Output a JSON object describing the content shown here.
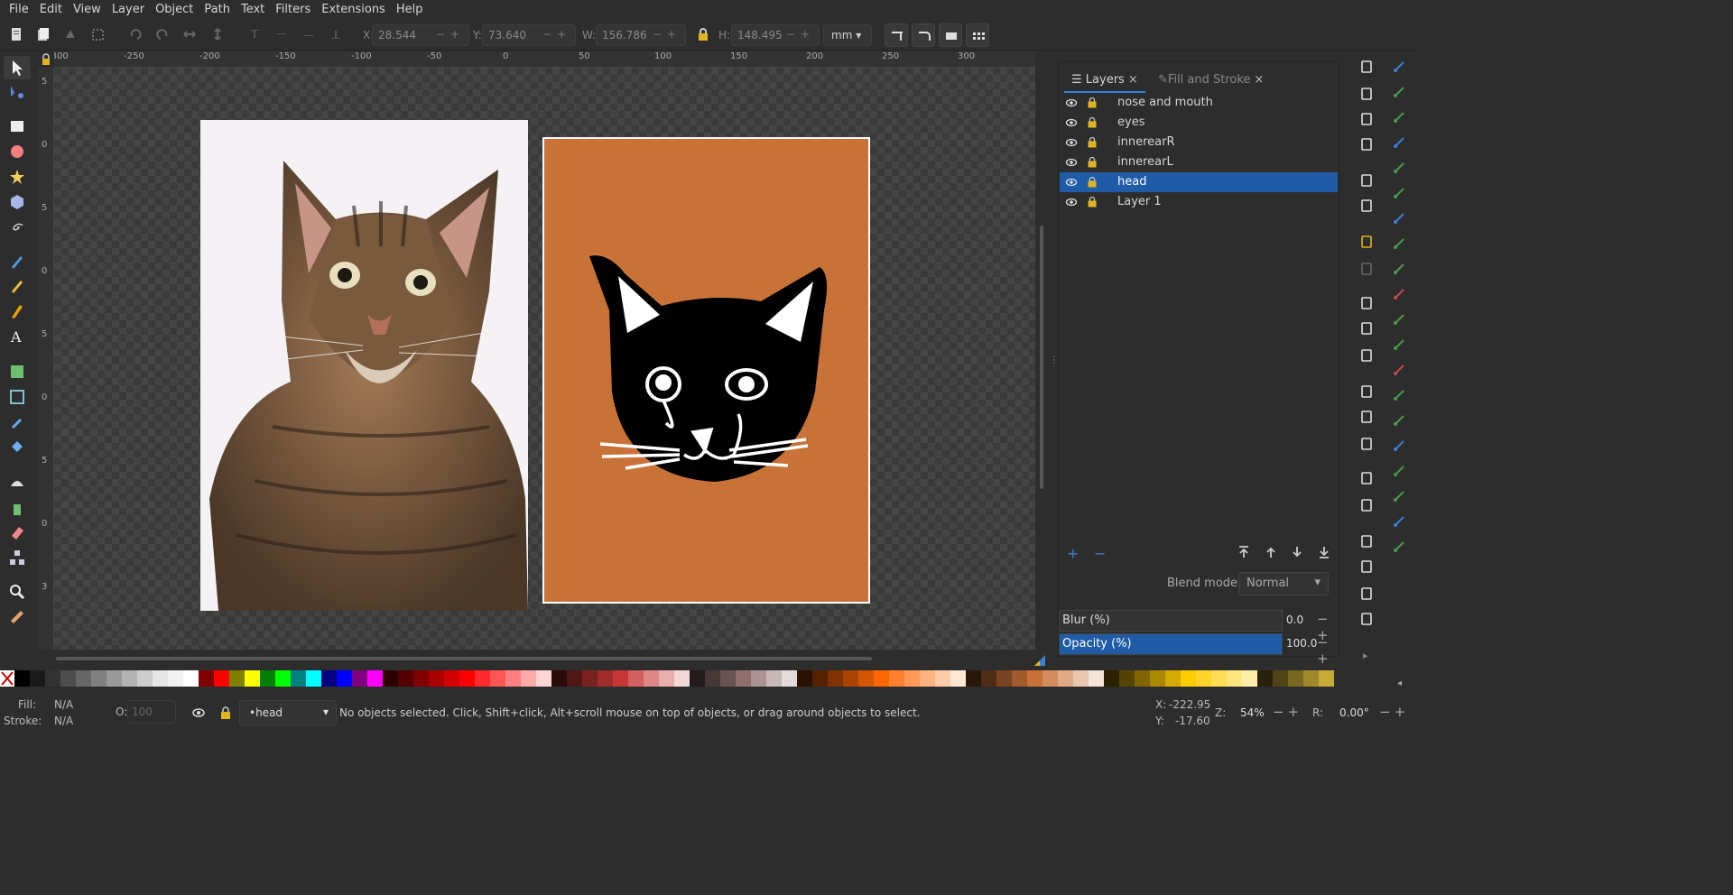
{
  "menu": [
    "File",
    "Edit",
    "View",
    "Layer",
    "Object",
    "Path",
    "Text",
    "Filters",
    "Extensions",
    "Help"
  ],
  "toolbar": {
    "x_label": "X:",
    "x_value": "28.544",
    "y_label": "Y:",
    "y_value": "73.640",
    "w_label": "W:",
    "w_value": "156.786",
    "h_label": "H:",
    "h_value": "148.495",
    "unit": "mm"
  },
  "ruler": {
    "top_ticks": [
      "-300",
      "-250",
      "-200",
      "-150",
      "-100",
      "-50",
      "0",
      "50",
      "100",
      "150",
      "200",
      "250",
      "300"
    ],
    "left_ticks": [
      "5",
      "0",
      "5",
      "0",
      "5",
      "0",
      "5",
      "0",
      "3"
    ]
  },
  "dock": {
    "tab_layers": "Layers",
    "tab_fill_stroke": "Fill and Stroke",
    "layers": [
      {
        "name": "nose and mouth",
        "selected": false
      },
      {
        "name": "eyes",
        "selected": false
      },
      {
        "name": "innerearR",
        "selected": false
      },
      {
        "name": "innerearL",
        "selected": false
      },
      {
        "name": "head",
        "selected": true
      },
      {
        "name": "Layer 1",
        "selected": false
      }
    ],
    "add_label": "+",
    "remove_label": "−",
    "blend_mode_label": "Blend mode:",
    "blend_mode_value": "Normal",
    "blur_label": "Blur (%)",
    "blur_value": "0.0",
    "opacity_label": "Opacity (%)",
    "opacity_value": "100.0"
  },
  "status": {
    "fill_label": "Fill:",
    "fill_value": "N/A",
    "stroke_label": "Stroke:",
    "stroke_value": "N/A",
    "opacity_label": "O:",
    "opacity_value": "100",
    "layer_value": "•head",
    "message": "No objects selected. Click, Shift+click, Alt+scroll mouse on top of objects, or drag around objects to select.",
    "x_label": "X:",
    "x_value": "-222.95",
    "y_label": "Y:",
    "y_value": "-17.60",
    "zoom_label": "Z:",
    "zoom_value": "54%",
    "rotation_label": "R:",
    "rotation_value": "0.00°"
  },
  "colors": {
    "accent": "#1f5ba7",
    "art_background": "#c87238"
  },
  "palette": [
    "#000000",
    "#1a1a1a",
    "#333333",
    "#4d4d4d",
    "#666666",
    "#808080",
    "#999999",
    "#b3b3b3",
    "#cccccc",
    "#e6e6e6",
    "#f2f2f2",
    "#ffffff",
    "#800000",
    "#ff0000",
    "#808000",
    "#ffff00",
    "#008000",
    "#00ff00",
    "#008080",
    "#00ffff",
    "#000080",
    "#0000ff",
    "#800080",
    "#ff00ff",
    "#2b0000",
    "#550000",
    "#800000",
    "#aa0000",
    "#d40000",
    "#ff0000",
    "#ff2a2a",
    "#ff5555",
    "#ff8080",
    "#ffaaaa",
    "#ffd5d5",
    "#280b0b",
    "#501616",
    "#782121",
    "#a02c2c",
    "#c83737",
    "#d35f5f",
    "#de8787",
    "#e9afaf",
    "#f4d7d7",
    "#241c1c",
    "#483737",
    "#6c5353",
    "#916f6f",
    "#ac9393",
    "#c8b7b7",
    "#e3dbdb",
    "#2b1100",
    "#552200",
    "#803300",
    "#aa4400",
    "#d45500",
    "#ff6600",
    "#ff7f2a",
    "#ff9955",
    "#ffb380",
    "#ffccaa",
    "#ffe6d5",
    "#28170b",
    "#502d16",
    "#784421",
    "#a05a2c",
    "#c87137",
    "#d38d5f",
    "#deaa87",
    "#e9c6af",
    "#f4e3d7",
    "#2b2200",
    "#554400",
    "#806600",
    "#aa8800",
    "#d4aa00",
    "#ffcc00",
    "#ffd42a",
    "#ffdd55",
    "#ffe680",
    "#ffeeaa",
    "#28220b",
    "#504416",
    "#786721",
    "#a0892c",
    "#c8ab37"
  ]
}
